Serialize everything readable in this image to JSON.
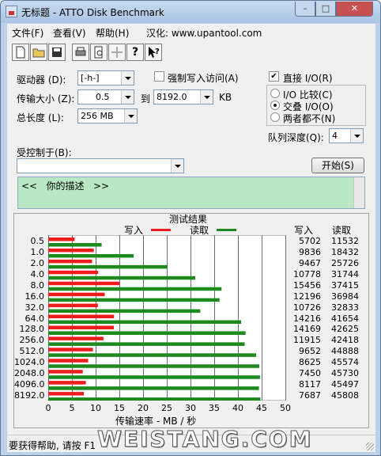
{
  "window": {
    "title": "无标题 - ATTO Disk Benchmark"
  },
  "menu": {
    "items": [
      "文件(F)",
      "查看(V)",
      "帮助(H)",
      "汉化: www.upantool.com"
    ]
  },
  "toolbar": {
    "icons": [
      "new-file-icon",
      "open-folder-icon",
      "save-icon",
      "print-icon",
      "print-preview-icon",
      "move-icon",
      "help-icon",
      "context-help-icon"
    ]
  },
  "form": {
    "drive_label": "驱动器 (D):",
    "drive_value": "[-h-]",
    "force_write_label": "强制写入访问(A)",
    "transfer_label": "传输大小 (Z):",
    "transfer_from": "0.5",
    "to_label": "到",
    "transfer_to": "8192.0",
    "kb_label": "KB",
    "total_label": "总长度 (L):",
    "total_value": "256 MB",
    "direct_io_label": "直接 I/O(R)",
    "direct_io_checked": true,
    "io_compare_label": "I/O 比较(C)",
    "overlapped_label": "交叠 I/O(O)",
    "neither_label": "两者都不(N)",
    "selected_io": "overlapped",
    "queue_label": "队列深度(Q):",
    "queue_value": "4",
    "controlled_label": "受控制于(B):",
    "controlled_value": "",
    "start_button": "开始(S)",
    "description": "<<   你的描述   >>"
  },
  "chart_data": {
    "type": "bar",
    "title": "测试结果",
    "legend": [
      {
        "name": "写入",
        "color": "#ee1c1c"
      },
      {
        "name": "读取",
        "color": "#1e8a1e"
      }
    ],
    "xlabel": "传输速率 - MB / 秒",
    "xlim": [
      0,
      50
    ],
    "xticks": [
      0,
      5,
      10,
      15,
      20,
      25,
      30,
      35,
      40,
      45,
      50
    ],
    "categories": [
      "0.5",
      "1.0",
      "2.0",
      "4.0",
      "8.0",
      "16.0",
      "32.0",
      "64.0",
      "128.0",
      "256.0",
      "512.0",
      "1024.0",
      "2048.0",
      "4096.0",
      "8192.0"
    ],
    "series": [
      {
        "name": "写入",
        "values": [
          5.57,
          9.61,
          9.25,
          10.53,
          15.09,
          11.91,
          10.47,
          13.88,
          13.84,
          11.64,
          9.43,
          8.42,
          7.28,
          7.93,
          7.51
        ]
      },
      {
        "name": "读取",
        "values": [
          11.26,
          18.0,
          25.12,
          31.0,
          36.54,
          36.12,
          32.06,
          40.68,
          41.62,
          41.42,
          43.83,
          44.51,
          44.66,
          44.43,
          44.73
        ]
      }
    ],
    "write_header": "写入",
    "read_header": "读取",
    "write_kb": [
      "5702",
      "9836",
      "9467",
      "10778",
      "15456",
      "12196",
      "10726",
      "14216",
      "14169",
      "11915",
      "9652",
      "8625",
      "7450",
      "8117",
      "7687"
    ],
    "read_kb": [
      "11532",
      "18432",
      "25726",
      "31744",
      "37415",
      "36984",
      "32833",
      "41654",
      "42625",
      "42418",
      "44888",
      "45574",
      "45730",
      "45497",
      "45808"
    ]
  },
  "status": {
    "text": "要获得帮助, 请按 F1"
  },
  "watermark": "WEISTANG.COM"
}
